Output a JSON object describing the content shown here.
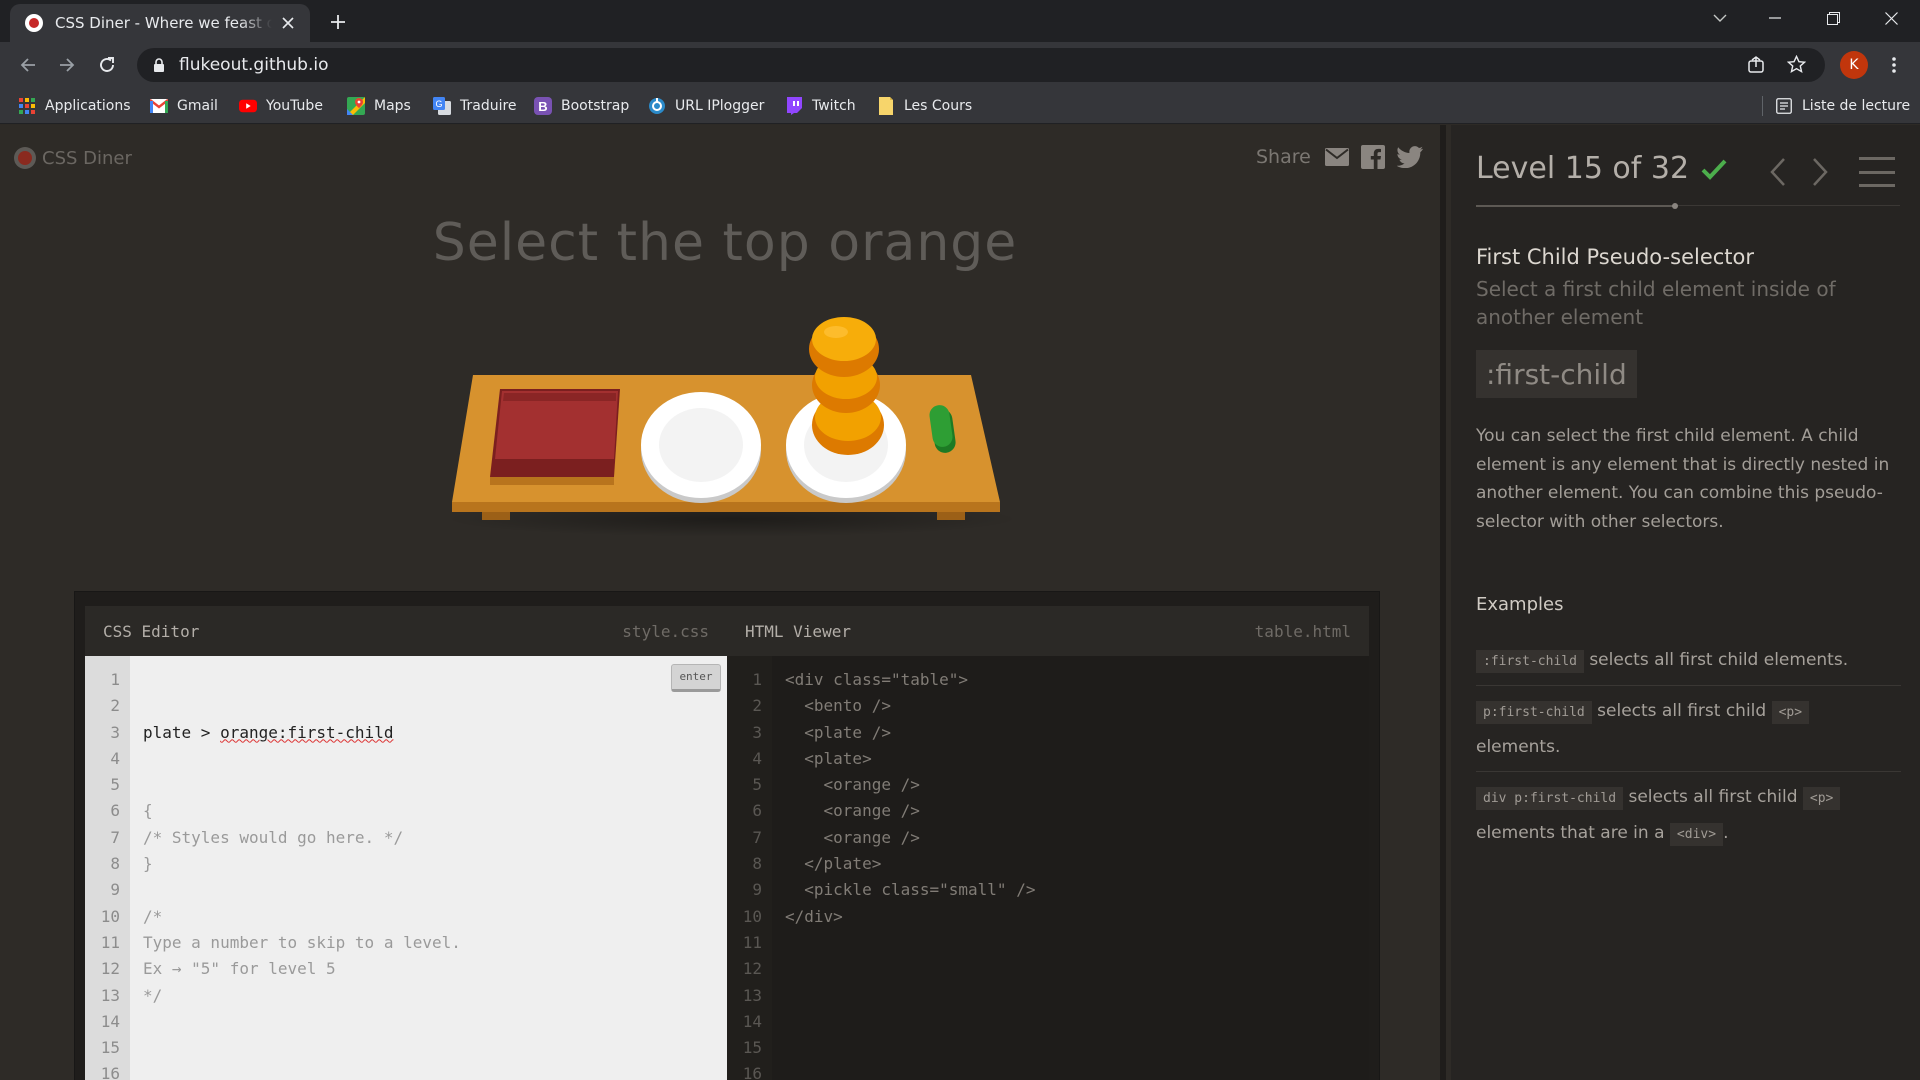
{
  "browser": {
    "tab_title": "CSS Diner - Where we feast on CSS Selectors!",
    "url": "flukeout.github.io",
    "avatar_letter": "K",
    "bookmarks": [
      {
        "label": "Applications",
        "icon": "apps-grid-icon"
      },
      {
        "label": "Gmail",
        "icon": "gmail-icon"
      },
      {
        "label": "YouTube",
        "icon": "youtube-icon"
      },
      {
        "label": "Maps",
        "icon": "maps-icon"
      },
      {
        "label": "Traduire",
        "icon": "translate-icon"
      },
      {
        "label": "Bootstrap",
        "icon": "bootstrap-icon"
      },
      {
        "label": "URL IPlogger",
        "icon": "iplogger-icon"
      },
      {
        "label": "Twitch",
        "icon": "twitch-icon"
      },
      {
        "label": "Les Cours",
        "icon": "folder-icon"
      }
    ],
    "reading_list": "Liste de lecture"
  },
  "page": {
    "logo": "CSS Diner",
    "share": "Share",
    "order": "Select the top orange"
  },
  "css_editor": {
    "title": "CSS Editor",
    "filename": "style.css",
    "input_value": "plate > orange:first-child",
    "enter_label": "enter",
    "lines": [
      "{",
      "/* Styles would go here. */",
      "}",
      "",
      "/*",
      "Type a number to skip to a level.",
      "Ex → \"5\" for level 5",
      "*/"
    ],
    "line_numbers": [
      "1",
      "2",
      "3",
      "4",
      "5",
      "6",
      "7",
      "8",
      "9",
      "10",
      "11",
      "12",
      "13",
      "14",
      "15",
      "16"
    ]
  },
  "html_viewer": {
    "title": "HTML Viewer",
    "filename": "table.html",
    "lines": [
      "<div class=\"table\">",
      "  <bento />",
      "  <plate />",
      "  <plate>",
      "    <orange />",
      "    <orange />",
      "    <orange />",
      "  </plate>",
      "  <pickle class=\"small\" />",
      "</div>"
    ],
    "line_numbers": [
      "1",
      "2",
      "3",
      "4",
      "5",
      "6",
      "7",
      "8",
      "9",
      "10",
      "11",
      "12",
      "13",
      "14",
      "15",
      "16"
    ]
  },
  "sidebar": {
    "level": "Level 15 of 32",
    "progress": 0.47,
    "title": "First Child Pseudo-selector",
    "subtitle": "Select a first child element inside of another element",
    "selector": ":first-child",
    "description": "You can select the first child element. A child element is any element that is directly nested in another element. You can combine this pseudo-selector with other selectors.",
    "examples_heading": "Examples",
    "examples": [
      {
        "code": ":first-child",
        "text": "selects all first child elements.",
        "code2": "",
        "text2": "",
        "code3": "",
        "text3": ""
      },
      {
        "code": "p:first-child",
        "text": "selects all first child",
        "code2": "<p>",
        "text2": "elements.",
        "code3": "",
        "text3": ""
      },
      {
        "code": "div p:first-child",
        "text": "selects all first child",
        "code2": "<p>",
        "text2": "elements that are in a",
        "code3": "<div>",
        "text3": "."
      }
    ]
  },
  "colors": {
    "accent_check": "#4cae4c",
    "table_wood": "#d7922e",
    "bento": "#9d2b2b",
    "orange": "#f2a100",
    "pickle": "#2e9e34"
  }
}
